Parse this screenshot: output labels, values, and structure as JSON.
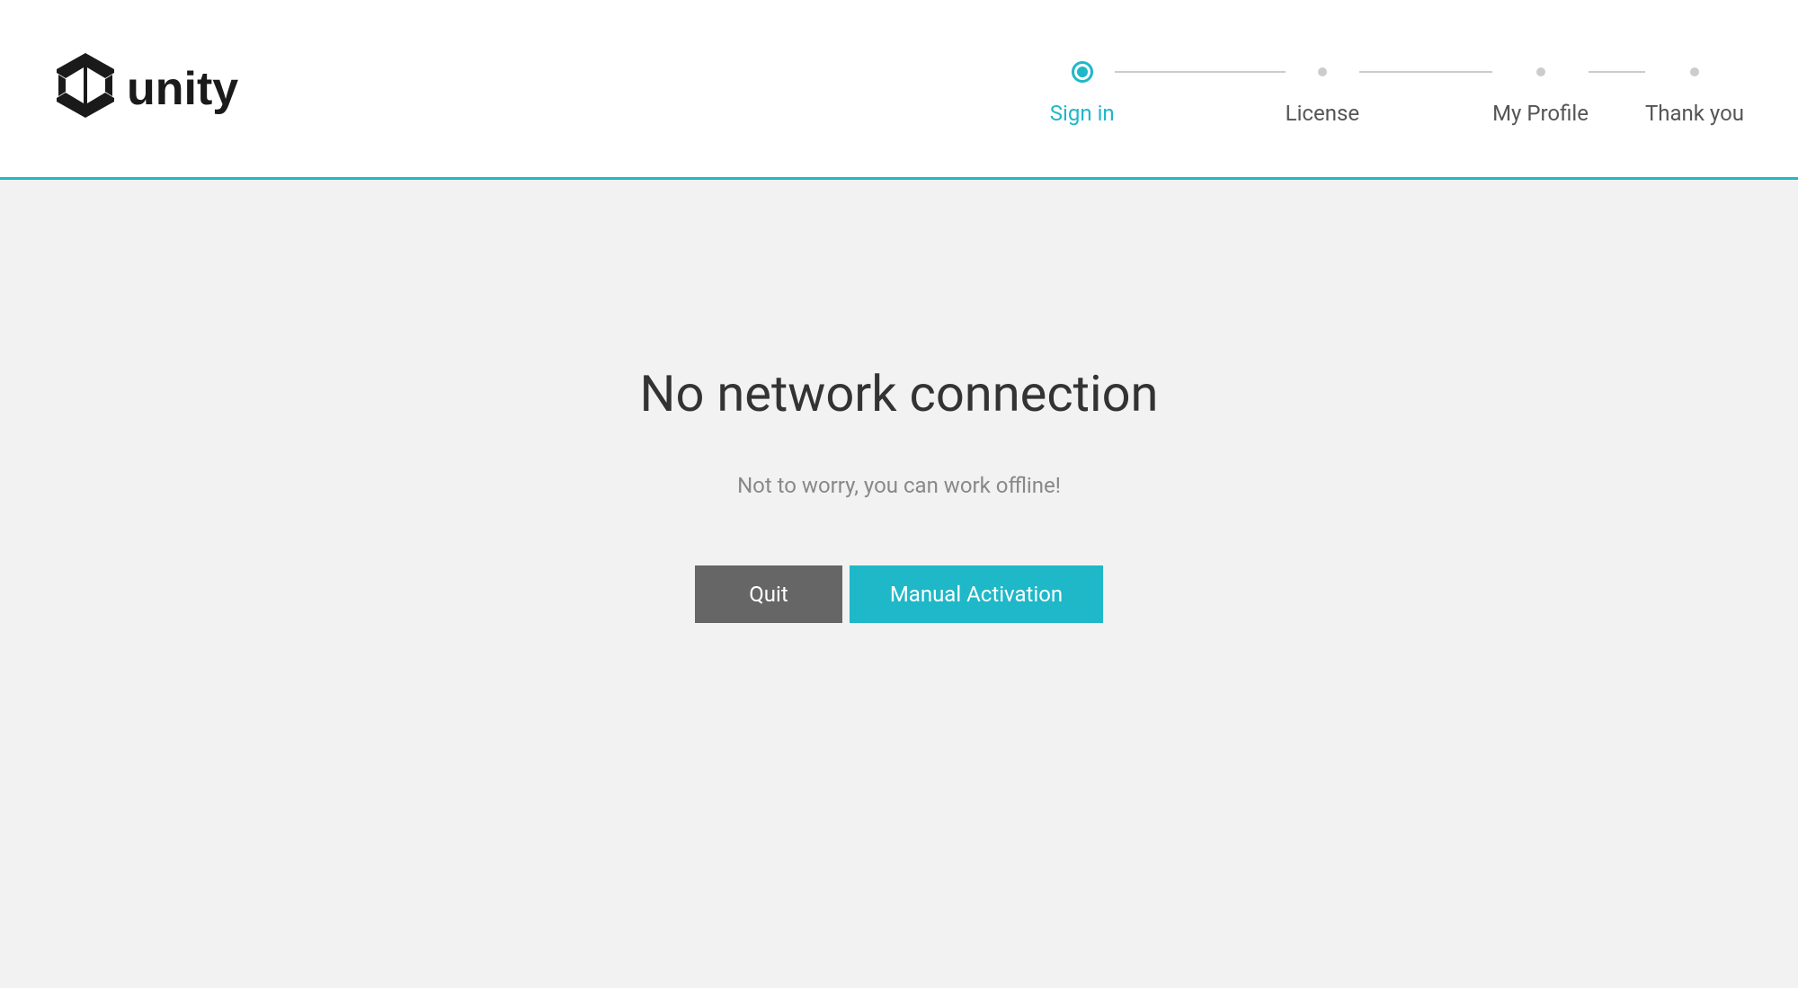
{
  "brand": {
    "name": "unity"
  },
  "stepper": {
    "steps": [
      {
        "label": "Sign in",
        "active": true
      },
      {
        "label": "License",
        "active": false
      },
      {
        "label": "My Profile",
        "active": false
      },
      {
        "label": "Thank you",
        "active": false
      }
    ]
  },
  "main": {
    "title": "No network connection",
    "subtitle": "Not to worry, you can work offline!",
    "quit_label": "Quit",
    "manual_activation_label": "Manual Activation"
  },
  "colors": {
    "accent": "#1eb8c8",
    "button_secondary": "#666666"
  }
}
